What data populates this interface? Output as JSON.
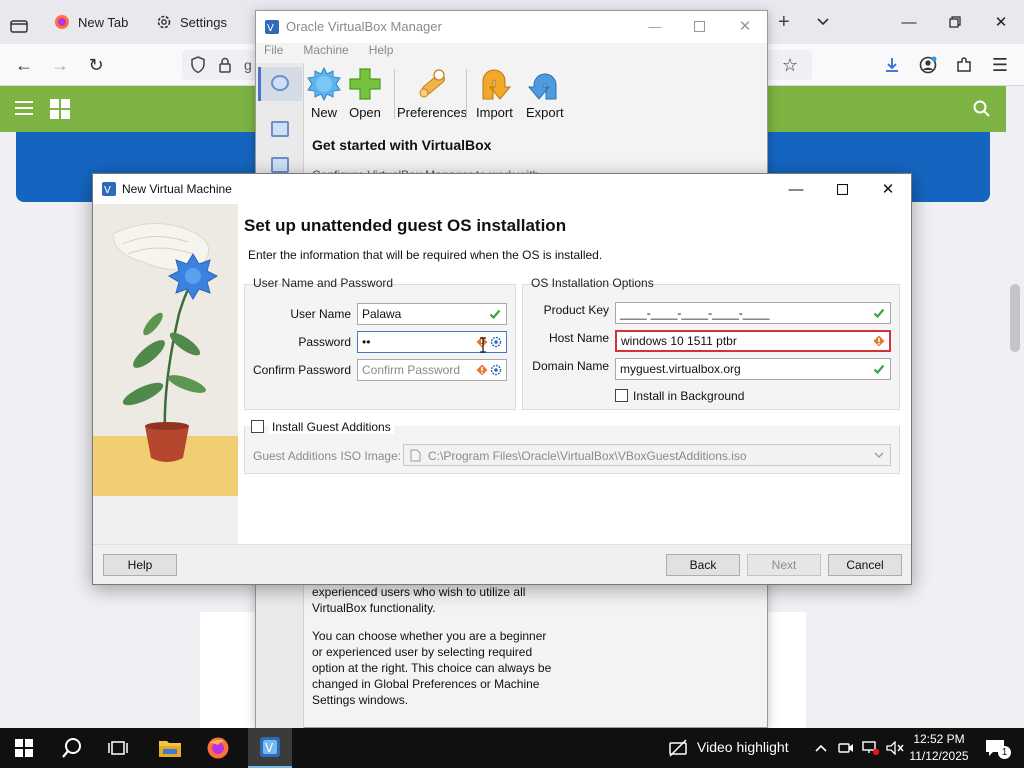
{
  "browser": {
    "tabs": [
      {
        "label": "New Tab"
      },
      {
        "label": "Settings"
      }
    ],
    "url_fragment": "g"
  },
  "vbox_manager": {
    "title": "Oracle VirtualBox Manager",
    "menu": [
      "File",
      "Machine",
      "Help"
    ],
    "toolbar": [
      {
        "label": "New",
        "icon": "new-icon"
      },
      {
        "label": "Open",
        "icon": "open-icon"
      },
      {
        "label": "Preferences",
        "icon": "preferences-icon"
      },
      {
        "label": "Import",
        "icon": "import-icon"
      },
      {
        "label": "Export",
        "icon": "export-icon"
      }
    ],
    "heading": "Get started with VirtualBox",
    "partial_line": "Configure VirtualBox Manager to work with",
    "paragraph1": [
      "experienced users who wish to utilize all",
      "VirtualBox functionality."
    ],
    "paragraph2": [
      "You can choose whether you are a beginner",
      "or experienced user by selecting required",
      "option at the right. This choice can always be",
      "changed in Global Preferences or Machine",
      "Settings windows."
    ]
  },
  "dialog": {
    "title": "New Virtual Machine",
    "heading": "Set up unattended guest OS installation",
    "subtitle": "Enter the information that will be required when the OS is installed.",
    "user_group": {
      "title": "User Name and Password",
      "username_label": "User Name",
      "username_value": "Palawa",
      "password_label": "Password",
      "password_value": "••",
      "confirm_label": "Confirm Password",
      "confirm_placeholder": "Confirm Password"
    },
    "os_group": {
      "title": "OS Installation Options",
      "product_key_label": "Product Key",
      "product_key_value": "____-____-____-____-____",
      "host_name_label": "Host Name",
      "host_name_value": "windows 10 1511 ptbr",
      "domain_name_label": "Domain Name",
      "domain_name_value": "myguest.virtualbox.org",
      "install_bg_label": "Install in Background"
    },
    "guest_additions": {
      "label": "Install Guest Additions",
      "iso_label": "Guest Additions ISO Image:",
      "iso_path": "C:\\Program Files\\Oracle\\VirtualBox\\VBoxGuestAdditions.iso"
    },
    "buttons": {
      "help": "Help",
      "back": "Back",
      "next": "Next",
      "cancel": "Cancel"
    }
  },
  "taskbar": {
    "notification": "Video highlight",
    "time": "12:52 PM",
    "date": "11/12/2025",
    "badge": "1"
  },
  "colors": {
    "accent_green": "#7cb342",
    "banner_blue": "#1565c0",
    "error_red": "#d13438",
    "ok_green": "#3aa53a"
  }
}
